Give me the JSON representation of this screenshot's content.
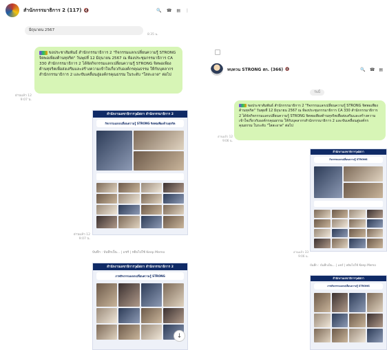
{
  "left": {
    "header": {
      "title": "สำนักกรรมาธิการ 2 (117)",
      "mute_icon": "🔇"
    },
    "prev_bubble": {
      "text": "มิถุนายน 2567",
      "time": "8:35 น."
    },
    "text_message": {
      "body": "ขอประชาสัมพันธ์ สำนักกรรมาธิการ 2 \"กิจกรรมแลกเปลี่ยนความรู้ STRONG จิตพอเพียงต้านทุจริต\" วันพุธที่ 12 มิถุนายน 2567 ณ ห้องประชุมกรรมาธิการ CA 330 สำนักกรรมาธิการ 2 ได้จัดกิจกรรมแลกเปลี่ยนความรู้ STRONG จิตพอเพียงต้านทุจริตเพื่อส่งเสริมและสร้างความเข้าใจเกี่ยวกับองค์กรคุณธรรม ให้กับบุคลากรสำนักกรรมาธิการ 2 และขับเคลื่อนสู่องค์กรคุณธรรม ในระดับ \"ใสสะอาด\" ต่อไป",
      "read": "อ่านแล้ว 12",
      "time": "9:07 น."
    },
    "image1": {
      "band": "สำนักงานเลขาธิการวุฒิสภา สำนักกรรมาธิการ 2",
      "sub": "กิจกรรมแลกเปลี่ยนความรู้ STRONG จิตพอเพียงต้านทุจริต",
      "read": "อ่านแล้ว 12",
      "time": "9:07 น."
    },
    "memo": "บันทึก : บันทึกเป็น... | แชร์ | หยิบไปใช้ Keep Memo",
    "image2": {
      "band": "สำนักงานเลขาธิการวุฒิสภา สำนักกรรมาธิการ 2",
      "sub": "ภาพกิจกรรมแลกเปลี่ยนความรู้ STRONG"
    },
    "fab_icon": "↓"
  },
  "right": {
    "header": {
      "title": "ทบทวน STRONG สก. (366)",
      "mute_icon": "🔇"
    },
    "day_label": "วันนี้",
    "text_message": {
      "body": "ขอประชาสัมพันธ์ สำนักกรรมาธิการ 2 \"กิจกรรมแลกเปลี่ยนความรู้ STRONG จิตพอเพียงต้านทุจริต\" วันพุธที่ 12 มิถุนายน 2567 ณ ห้องประชุมกรรมาธิการ CA 330 สำนักกรรมาธิการ 2 ได้จัดกิจกรรมแลกเปลี่ยนความรู้ STRONG จิตพอเพียงต้านทุจริตเพื่อส่งเสริมและสร้างความเข้าใจเกี่ยวกับองค์กรคุณธรรม ให้กับบุคลากรสำนักกรรมาธิการ 2 และขับเคลื่อนสู่องค์กรคุณธรรม ในระดับ \"ใสสะอาด\" ต่อไป",
      "read": "อ่านแล้ว 12",
      "time": "9:06 น."
    },
    "image1": {
      "band": "สำนักงานเลขาธิการวุฒิสภา",
      "sub": "กิจกรรมแลกเปลี่ยนความรู้ STRONG",
      "read": "อ่านแล้ว 33",
      "time": "9:06 น."
    },
    "memo": "บันทึก : บันทึกเป็น... | แชร์ | หยิบไปใช้ Keep Memo",
    "image2": {
      "band": "สำนักงานเลขาธิการวุฒิสภา",
      "sub": "ภาพกิจกรรมแลกเปลี่ยนความรู้ STRONG"
    }
  },
  "icons": {
    "search": "🔍",
    "phone": "☎",
    "notes": "▤",
    "more": "⋮"
  },
  "colors": {
    "bubble_green": "#d7f5b6",
    "poster_navy": "#0f2a66"
  }
}
